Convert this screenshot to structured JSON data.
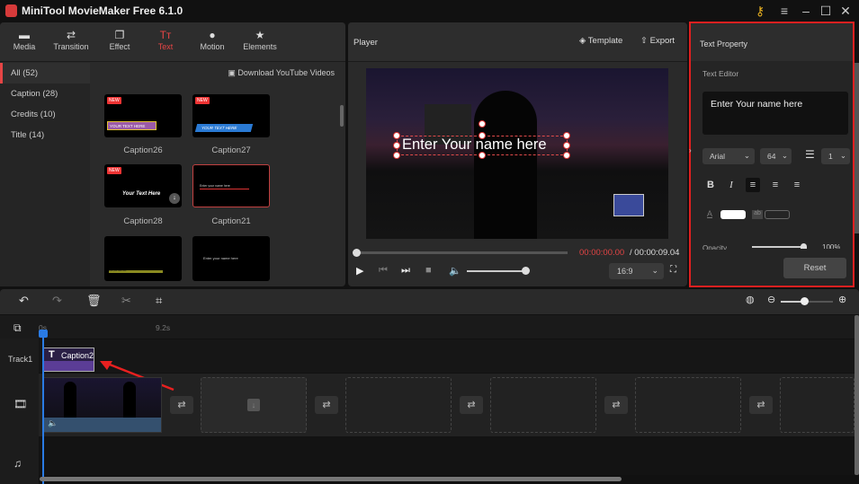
{
  "app": {
    "title": "MiniTool MovieMaker Free 6.1.0"
  },
  "window_controls": {
    "key": "key-icon",
    "menu": "menu-icon",
    "minimize": "minimize-icon",
    "maximize": "maximize-icon",
    "close": "close-icon"
  },
  "toolbar": {
    "items": [
      {
        "label": "Media",
        "icon": "folder-icon"
      },
      {
        "label": "Transition",
        "icon": "swap-arrows-icon"
      },
      {
        "label": "Effect",
        "icon": "effect-icon"
      },
      {
        "label": "Text",
        "icon": "text-icon",
        "active": true
      },
      {
        "label": "Motion",
        "icon": "motion-icon"
      },
      {
        "label": "Elements",
        "icon": "elements-icon"
      }
    ]
  },
  "library": {
    "categories": [
      {
        "label": "All (52)",
        "active": true
      },
      {
        "label": "Caption (28)"
      },
      {
        "label": "Credits (10)"
      },
      {
        "label": "Title (14)"
      }
    ],
    "download_link": "Download YouTube Videos",
    "new_badge": "NEW",
    "thumbnails": [
      {
        "label": "Caption26",
        "preview_text": "YOUR TEXT HERE",
        "new": true
      },
      {
        "label": "Caption27",
        "preview_text": "YOUR TEXT HERE",
        "new": true
      },
      {
        "label": "Caption28",
        "preview_text": "Your Text Here",
        "new": true
      },
      {
        "label": "Caption21",
        "preview_text": "Enter your name here",
        "selected": true
      },
      {
        "label": "",
        "preview_text": "Enter your name here"
      },
      {
        "label": "",
        "preview_text": "Enter your name here"
      }
    ]
  },
  "player": {
    "title": "Player",
    "template_label": "Template",
    "export_label": "Export",
    "overlay_text": "Enter Your name here",
    "time_current": "00:00:00.00",
    "time_separator": " / ",
    "time_total": "00:00:09.04",
    "aspect_ratio": "16:9",
    "progress": 0,
    "volume": 1.0
  },
  "text_property": {
    "title": "Text Property",
    "editor_label": "Text Editor",
    "text_value": "Enter Your name here",
    "font": "Arial",
    "size": "64",
    "line_spacing": "1",
    "format_buttons": [
      "B",
      "I"
    ],
    "color_label": "A",
    "bg_label": "ab",
    "text_color": "#ffffff",
    "opacity_label": "Opacity",
    "opacity_value": "100%",
    "reset_label": "Reset"
  },
  "timeline": {
    "ruler": [
      "0s",
      "9.2s"
    ],
    "track1_label": "Track1",
    "caption_clip": "Caption2",
    "zoom_level": 0.45
  },
  "colors": {
    "accent": "#e64545",
    "highlight_box": "#e02020",
    "caption_clip": "#5b3d96",
    "playhead": "#2a7be4"
  }
}
